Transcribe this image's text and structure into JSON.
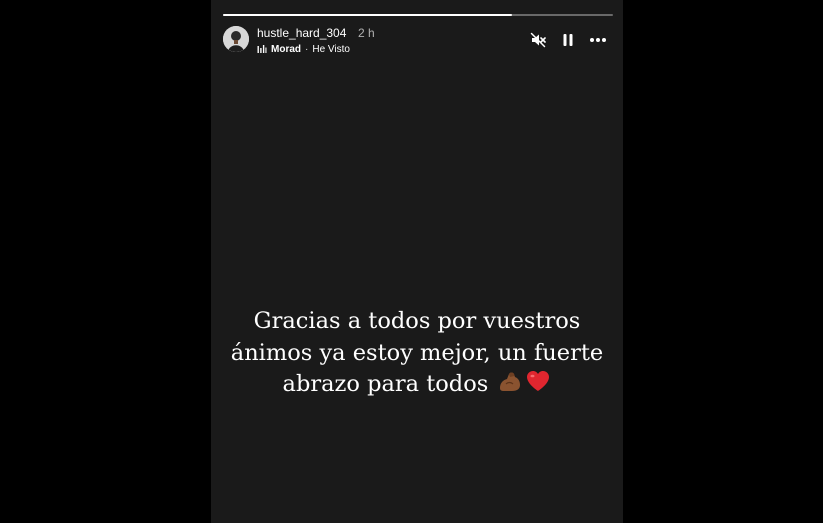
{
  "story": {
    "progress_fraction": 0.74,
    "header": {
      "username": "hustle_hard_304",
      "time_ago": "2 h",
      "music": {
        "icon": "music-bars-icon",
        "artist": "Morad",
        "separator": "·",
        "song": "He Visto"
      },
      "controls": [
        {
          "name": "mute-icon"
        },
        {
          "name": "pause-icon"
        },
        {
          "name": "more-options-icon"
        }
      ]
    },
    "caption": {
      "lines": [
        "Gracias a todos por vuestros",
        "ánimos ya estoy mejor, un fuerte",
        "abrazo para todos"
      ],
      "emojis": [
        "flexed-biceps-emoji",
        "red-heart-emoji"
      ]
    },
    "colors": {
      "background": "#1a1a1a",
      "page": "#000000",
      "text": "#ffffff",
      "progress_track": "rgba(255,255,255,0.35)",
      "progress_fill": "#ffffff",
      "heart": "#e0262f",
      "biceps": "#8a5330"
    }
  }
}
